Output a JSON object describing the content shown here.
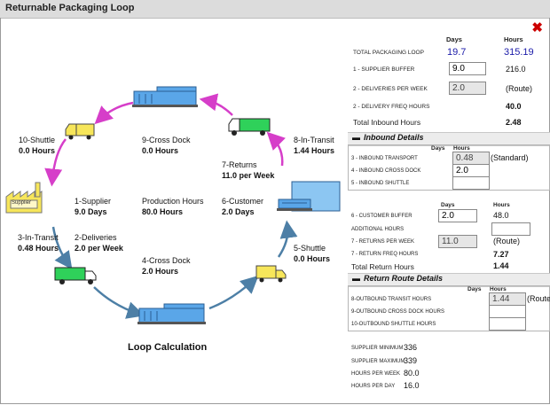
{
  "window": {
    "title": "Returnable Packaging Loop",
    "close_icon": "close-x-icon"
  },
  "diagram": {
    "title": "Loop Calculation",
    "center_label": "Production Hours",
    "center_value": "80.0 Hours",
    "supplier_box_text": "Supplier",
    "nodes": {
      "shuttle10": {
        "label": "10-Shuttle",
        "value": "0.0 Hours"
      },
      "crossdock9": {
        "label": "9-Cross Dock",
        "value": "0.0 Hours"
      },
      "intransit8": {
        "label": "8-In-Transit",
        "value": "1.44 Hours"
      },
      "returns7": {
        "label": "7-Returns",
        "value": "11.0 per Week"
      },
      "supplier1": {
        "label": "1-Supplier",
        "value": "9.0 Days"
      },
      "customer6": {
        "label": "6-Customer",
        "value": "2.0 Days"
      },
      "intransit3": {
        "label": "3-In-Transit",
        "value": "0.48 Hours"
      },
      "deliveries2": {
        "label": "2-Deliveries",
        "value": "2.0 per Week"
      },
      "crossdock4": {
        "label": "4-Cross Dock",
        "value": "2.0 Hours"
      },
      "shuttle5": {
        "label": "5-Shuttle",
        "value": "0.0 Hours"
      }
    },
    "colors": {
      "inbound_arrow": "#d63ec9",
      "outbound_arrow": "#4d7fa6",
      "truck_green": "#2fd15a",
      "truck_yellow": "#f7e65a",
      "building_blue": "#5aa6e8"
    }
  },
  "panel": {
    "col_days": "Days",
    "col_hours": "Hours",
    "total_loop": {
      "label": "TOTAL PACKAGING LOOP",
      "days": "19.7",
      "hours": "315.19"
    },
    "supplier_buffer": {
      "label": "1 - SUPPLIER BUFFER",
      "days": "9.0",
      "hours": "216.0"
    },
    "deliveries_per_week": {
      "label": "2 - DELIVERIES PER WEEK",
      "value": "2.0",
      "note": "(Route)"
    },
    "delivery_freq": {
      "label": "2 - DELIVERY FREQ HOURS",
      "hours": "40.0"
    },
    "total_inbound": {
      "label": "Total Inbound Hours",
      "hours": "2.48"
    },
    "inbound_details": {
      "title": "Inbound Details",
      "col_days": "Days",
      "col_hours": "Hours",
      "transport": {
        "label": "3 - INBOUND TRANSPORT",
        "hours": "0.48",
        "note": "(Standard)"
      },
      "cross_dock": {
        "label": "4 - INBOUND CROSS DOCK",
        "hours": "2.0"
      },
      "shuttle": {
        "label": "5 - INBOUND SHUTTLE",
        "hours": ""
      }
    },
    "customer": {
      "col_days": "Days",
      "col_hours": "Hours",
      "buffer": {
        "label": "6 - CUSTOMER BUFFER",
        "days": "2.0",
        "hours": "48.0"
      },
      "additional": {
        "label": "ADDITIONAL HOURS",
        "hours": ""
      },
      "returns_per_week": {
        "label": "7 - RETURNS PER WEEK",
        "value": "11.0",
        "note": "(Route)"
      },
      "return_freq": {
        "label": "7 - RETURN FREQ HOURS",
        "hours": "7.27"
      },
      "total_return": {
        "label": "Total Return Hours",
        "hours": "1.44"
      }
    },
    "return_route": {
      "title": "Return Route Details",
      "col_days": "Days",
      "col_hours": "Hours",
      "outbound_transit": {
        "label": "8-OUTBOUND TRANSIT HOURS",
        "hours": "1.44",
        "note": "(Route"
      },
      "outbound_cross_dock": {
        "label": "9-OUTBOUND CROSS DOCK HOURS",
        "hours": ""
      },
      "outbound_shuttle": {
        "label": "10-OUTBOUND SHUTTLE HOURS",
        "hours": ""
      }
    },
    "summary": {
      "supplier_min": {
        "label": "SUPPLIER MINIMUM",
        "value": "336"
      },
      "supplier_max": {
        "label": "SUPPLIER MAXIMUM",
        "value": "339"
      },
      "hours_per_week": {
        "label": "HOURS PER WEEK",
        "value": "80.0"
      },
      "hours_per_day": {
        "label": "HOURS PER DAY",
        "value": "16.0"
      }
    }
  }
}
